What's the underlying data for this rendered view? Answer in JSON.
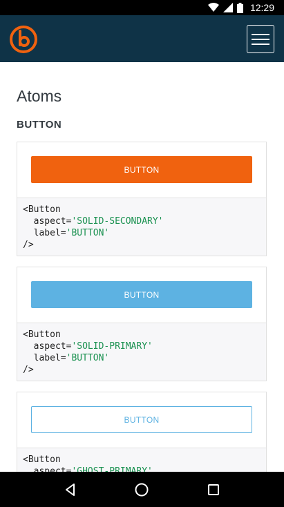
{
  "status_bar": {
    "time": "12:29",
    "icons": [
      "wifi-icon",
      "signal-icon",
      "battery-icon"
    ]
  },
  "header": {
    "logo": "brand-logo",
    "menu_icon": "hamburger-menu-icon"
  },
  "page": {
    "title": "Atoms",
    "section": "BUTTON"
  },
  "examples": [
    {
      "button_label": "BUTTON",
      "style": "solid-secondary",
      "code": {
        "line1": "<Button",
        "prop1": "aspect=",
        "val1": "'SOLID-SECONDARY'",
        "prop2": "label=",
        "val2": "'BUTTON'",
        "close": "/>"
      }
    },
    {
      "button_label": "BUTTON",
      "style": "solid-primary",
      "code": {
        "line1": "<Button",
        "prop1": "aspect=",
        "val1": "'SOLID-PRIMARY'",
        "prop2": "label=",
        "val2": "'BUTTON'",
        "close": "/>"
      }
    },
    {
      "button_label": "BUTTON",
      "style": "ghost-primary",
      "code": {
        "line1": "<Button",
        "prop1": "aspect=",
        "val1": "'GHOST-PRIMARY'"
      }
    }
  ],
  "colors": {
    "header_bg": "#0f3347",
    "brand_orange": "#f0620f",
    "primary_blue": "#5db2e2",
    "code_string": "#1a9150"
  },
  "nav_bar": {
    "icons": [
      "back-icon",
      "home-icon",
      "recents-icon"
    ]
  }
}
